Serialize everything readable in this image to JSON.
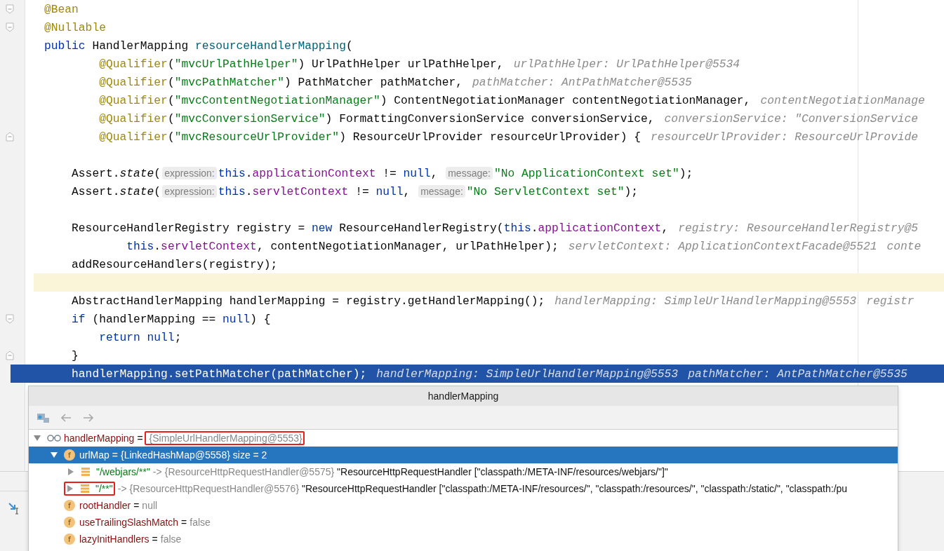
{
  "editor": {
    "lines": [
      {
        "fold_open": true,
        "tokens": [
          {
            "kind": "annotation",
            "text": "@Bean"
          }
        ]
      },
      {
        "fold_open": true,
        "tokens": [
          {
            "kind": "annotation",
            "text": "@Nullable"
          }
        ]
      },
      {
        "tokens": [
          {
            "kind": "keyword",
            "text": "public "
          },
          {
            "kind": "plain",
            "text": "HandlerMapping "
          },
          {
            "kind": "declaration",
            "text": "resourceHandlerMapping"
          },
          {
            "kind": "plain",
            "text": "("
          }
        ]
      },
      {
        "tokens": [
          {
            "kind": "annotation",
            "text": "        @Qualifier"
          },
          {
            "kind": "plain",
            "text": "("
          },
          {
            "kind": "string",
            "text": "\"mvcUrlPathHelper\""
          },
          {
            "kind": "plain",
            "text": ") UrlPathHelper urlPathHelper,"
          },
          {
            "kind": "hint",
            "text": "urlPathHelper: UrlPathHelper@5534"
          }
        ]
      },
      {
        "tokens": [
          {
            "kind": "annotation",
            "text": "        @Qualifier"
          },
          {
            "kind": "plain",
            "text": "("
          },
          {
            "kind": "string",
            "text": "\"mvcPathMatcher\""
          },
          {
            "kind": "plain",
            "text": ") PathMatcher pathMatcher,"
          },
          {
            "kind": "hint",
            "text": "pathMatcher: AntPathMatcher@5535"
          }
        ]
      },
      {
        "tokens": [
          {
            "kind": "annotation",
            "text": "        @Qualifier"
          },
          {
            "kind": "plain",
            "text": "("
          },
          {
            "kind": "string",
            "text": "\"mvcContentNegotiationManager\""
          },
          {
            "kind": "plain",
            "text": ") ContentNegotiationManager contentNegotiationManager,"
          },
          {
            "kind": "hint",
            "text": "contentNegotiationManage"
          }
        ]
      },
      {
        "tokens": [
          {
            "kind": "annotation",
            "text": "        @Qualifier"
          },
          {
            "kind": "plain",
            "text": "("
          },
          {
            "kind": "string",
            "text": "\"mvcConversionService\""
          },
          {
            "kind": "plain",
            "text": ") FormattingConversionService conversionService,"
          },
          {
            "kind": "hint",
            "text": "conversionService: \"ConversionService"
          }
        ]
      },
      {
        "fold_close": true,
        "tokens": [
          {
            "kind": "annotation",
            "text": "        @Qualifier"
          },
          {
            "kind": "plain",
            "text": "("
          },
          {
            "kind": "string",
            "text": "\"mvcResourceUrlProvider\""
          },
          {
            "kind": "plain",
            "text": ") ResourceUrlProvider resourceUrlProvider) {"
          },
          {
            "kind": "hint",
            "text": "resourceUrlProvider: ResourceUrlProvide"
          }
        ]
      },
      {
        "current": false
      },
      {
        "tokens": [
          {
            "kind": "plain",
            "text": "    Assert."
          },
          {
            "kind": "static",
            "text": "state"
          },
          {
            "kind": "plain",
            "text": "("
          },
          {
            "kind": "param",
            "text": "expression:"
          },
          {
            "kind": "keyword",
            "text": "this"
          },
          {
            "kind": "plain",
            "text": "."
          },
          {
            "kind": "field",
            "text": "applicationContext"
          },
          {
            "kind": "plain",
            "text": " != "
          },
          {
            "kind": "keyword",
            "text": "null"
          },
          {
            "kind": "plain",
            "text": ", "
          },
          {
            "kind": "param",
            "text": "message:"
          },
          {
            "kind": "string",
            "text": "\"No ApplicationContext set\""
          },
          {
            "kind": "plain",
            "text": ");"
          }
        ]
      },
      {
        "tokens": [
          {
            "kind": "plain",
            "text": "    Assert."
          },
          {
            "kind": "static",
            "text": "state"
          },
          {
            "kind": "plain",
            "text": "("
          },
          {
            "kind": "param",
            "text": "expression:"
          },
          {
            "kind": "keyword",
            "text": "this"
          },
          {
            "kind": "plain",
            "text": "."
          },
          {
            "kind": "field",
            "text": "servletContext"
          },
          {
            "kind": "plain",
            "text": " != "
          },
          {
            "kind": "keyword",
            "text": "null"
          },
          {
            "kind": "plain",
            "text": ", "
          },
          {
            "kind": "param",
            "text": "message:"
          },
          {
            "kind": "string",
            "text": "\"No ServletContext set\""
          },
          {
            "kind": "plain",
            "text": ");"
          }
        ]
      },
      {
        "current": false
      },
      {
        "tokens": [
          {
            "kind": "plain",
            "text": "    ResourceHandlerRegistry registry = "
          },
          {
            "kind": "keyword",
            "text": "new "
          },
          {
            "kind": "plain",
            "text": "ResourceHandlerRegistry("
          },
          {
            "kind": "keyword",
            "text": "this"
          },
          {
            "kind": "plain",
            "text": "."
          },
          {
            "kind": "field",
            "text": "applicationContext"
          },
          {
            "kind": "plain",
            "text": ","
          },
          {
            "kind": "hint",
            "text": "registry: ResourceHandlerRegistry@5"
          }
        ]
      },
      {
        "tokens": [
          {
            "kind": "keyword",
            "text": "            this"
          },
          {
            "kind": "plain",
            "text": "."
          },
          {
            "kind": "field",
            "text": "servletContext"
          },
          {
            "kind": "plain",
            "text": ", contentNegotiationManager, urlPathHelper);"
          },
          {
            "kind": "hint",
            "text": "servletContext: ApplicationContextFacade@5521"
          },
          {
            "kind": "hint",
            "text": "conte"
          }
        ]
      },
      {
        "tokens": [
          {
            "kind": "plain",
            "text": "    addResourceHandlers(registry);"
          }
        ]
      },
      {
        "current": true
      },
      {
        "tokens": [
          {
            "kind": "plain",
            "text": "    AbstractHandlerMapping handlerMapping = registry.getHandlerMapping();"
          },
          {
            "kind": "hint",
            "text": "handlerMapping: SimpleUrlHandlerMapping@5553"
          },
          {
            "kind": "hint",
            "text": "registr"
          }
        ]
      },
      {
        "fold_open": true,
        "tokens": [
          {
            "kind": "keyword",
            "text": "    if "
          },
          {
            "kind": "plain",
            "text": "(handlerMapping == "
          },
          {
            "kind": "keyword",
            "text": "null"
          },
          {
            "kind": "plain",
            "text": ") {"
          }
        ]
      },
      {
        "tokens": [
          {
            "kind": "keyword",
            "text": "        return null"
          },
          {
            "kind": "plain",
            "text": ";"
          }
        ]
      },
      {
        "fold_close": true,
        "tokens": [
          {
            "kind": "plain",
            "text": "    }"
          }
        ]
      },
      {
        "selected": true,
        "tokens": [
          {
            "kind": "plain",
            "text": "    handlerMapping.setPathMatcher(pathMatcher);"
          },
          {
            "kind": "hint",
            "text": "handlerMapping: SimpleUrlHandlerMapping@5553"
          },
          {
            "kind": "hint",
            "text": "pathMatcher: AntPathMatcher@5535"
          }
        ]
      }
    ]
  },
  "popup": {
    "title": "handlerMapping",
    "tree": [
      {
        "kind": "watch",
        "name": "handlerMapping",
        "separator": "=",
        "value": "{SimpleUrlHandlerMapping@5553}",
        "expanded": true,
        "selected": false,
        "marked": true,
        "children": [
          {
            "kind": "field",
            "badge": "f",
            "name": "urlMap",
            "separator": "=",
            "value": "{LinkedHashMap@5558}",
            "extra": "size = 2",
            "expanded": true,
            "selected": true,
            "children": [
              {
                "kind": "entry",
                "name": "\"/webjars/**\"",
                "separator": "->",
                "value": "{ResourceHttpRequestHandler@5575}",
                "extra": "\"ResourceHttpRequestHandler [\"classpath:/META-INF/resources/webjars/\"]\"",
                "expanded": false,
                "selected": false,
                "marked": false
              },
              {
                "kind": "entry",
                "name": "\"/**\"",
                "separator": "->",
                "value": "{ResourceHttpRequestHandler@5576}",
                "extra": "\"ResourceHttpRequestHandler [\"classpath:/META-INF/resources/\", \"classpath:/resources/\", \"classpath:/static/\", \"classpath:/pu",
                "expanded": false,
                "selected": false,
                "marked": true
              }
            ]
          },
          {
            "kind": "field",
            "badge": "f",
            "name": "rootHandler",
            "separator": "=",
            "value": "null",
            "selected": false
          },
          {
            "kind": "field",
            "badge": "f",
            "name": "useTrailingSlashMatch",
            "separator": "=",
            "value": "false",
            "selected": false
          },
          {
            "kind": "field",
            "badge": "f",
            "name": "lazyInitHandlers",
            "separator": "=",
            "value": "false",
            "selected": false
          }
        ]
      }
    ]
  }
}
